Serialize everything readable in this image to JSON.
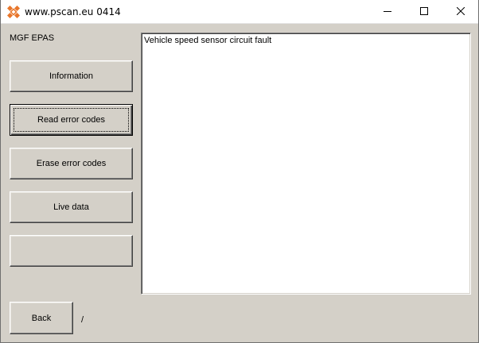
{
  "window": {
    "title": "www.pscan.eu 0414",
    "icon": "pscan-logo-icon",
    "controls": {
      "minimize": "minimize-icon",
      "maximize": "maximize-icon",
      "close": "close-icon"
    }
  },
  "device": {
    "label": "MGF EPAS"
  },
  "menu": {
    "items": [
      {
        "label": "Information"
      },
      {
        "label": "Read error codes"
      },
      {
        "label": "Erase error codes"
      },
      {
        "label": "Live data"
      },
      {
        "label": ""
      }
    ]
  },
  "output": {
    "text": "Vehicle speed sensor circuit fault"
  },
  "footer": {
    "back_label": "Back",
    "status_text": "/"
  },
  "colors": {
    "background": "#d4d0c8",
    "titlebar": "#ffffff",
    "output_bg": "#ffffff",
    "logo_accent": "#e8762b"
  }
}
